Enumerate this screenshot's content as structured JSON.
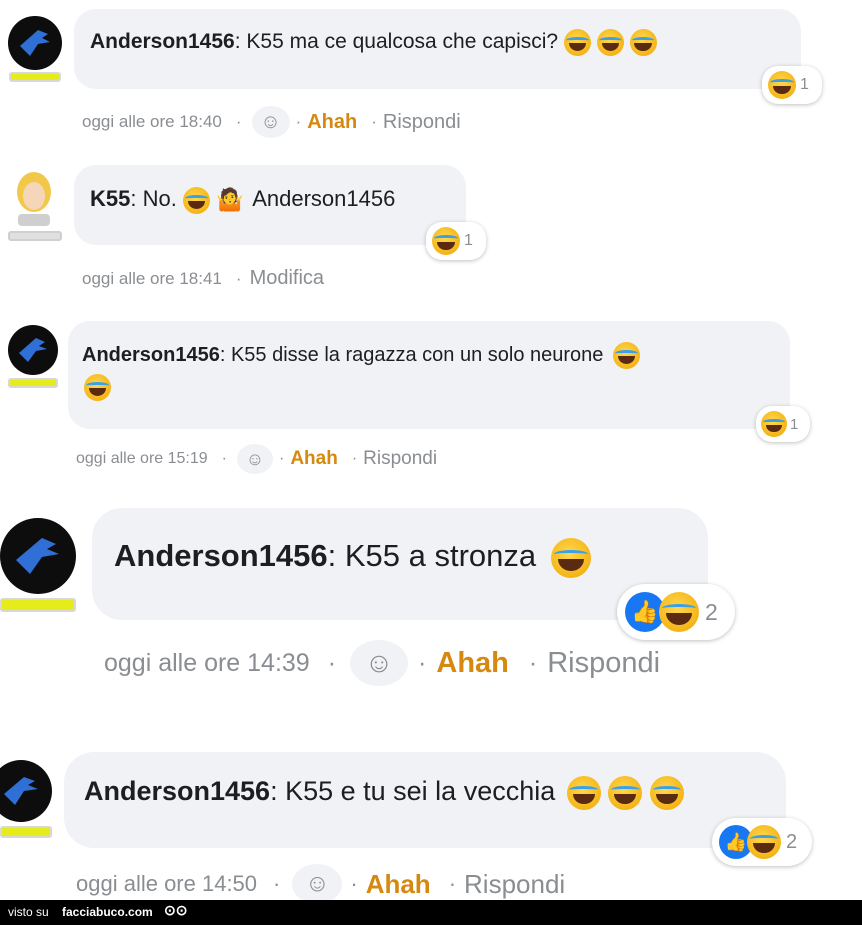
{
  "comments": [
    {
      "author": "Anderson1456",
      "text": ": K55 ma ce qualcosa che capisci?",
      "reaction_count": "1",
      "time": "oggi alle ore 18:40",
      "sep": "·",
      "action1": "Ahah",
      "action2": "Rispondi"
    },
    {
      "author": "K55",
      "text": ": No.",
      "mention": "Anderson1456",
      "reaction_count": "1",
      "time": "oggi alle ore 18:41",
      "sep": "·",
      "action1": "Modifica"
    },
    {
      "author": "Anderson1456",
      "text": ": K55 disse la ragazza con un solo neurone",
      "reaction_count": "1",
      "time": "oggi alle ore 15:19",
      "sep": "·",
      "action1": "Ahah",
      "action2": "Rispondi"
    },
    {
      "author": "Anderson1456",
      "text": ": K55 a stronza",
      "reaction_count": "2",
      "time": "oggi alle ore 14:39",
      "sep": "·",
      "action1": "Ahah",
      "action2": "Rispondi"
    },
    {
      "author": "Anderson1456",
      "text": ": K55 e tu sei la vecchia",
      "reaction_count": "2",
      "time": "oggi alle ore 14:50",
      "sep": "·",
      "action1": "Ahah",
      "action2": "Rispondi"
    }
  ],
  "footer": {
    "visto": "visto su",
    "site": "facciabuco.com"
  },
  "colors": {
    "bubble": "#f0f2f5",
    "ahah": "#d68910",
    "meta": "#8a8d91",
    "like": "#1877f2"
  }
}
